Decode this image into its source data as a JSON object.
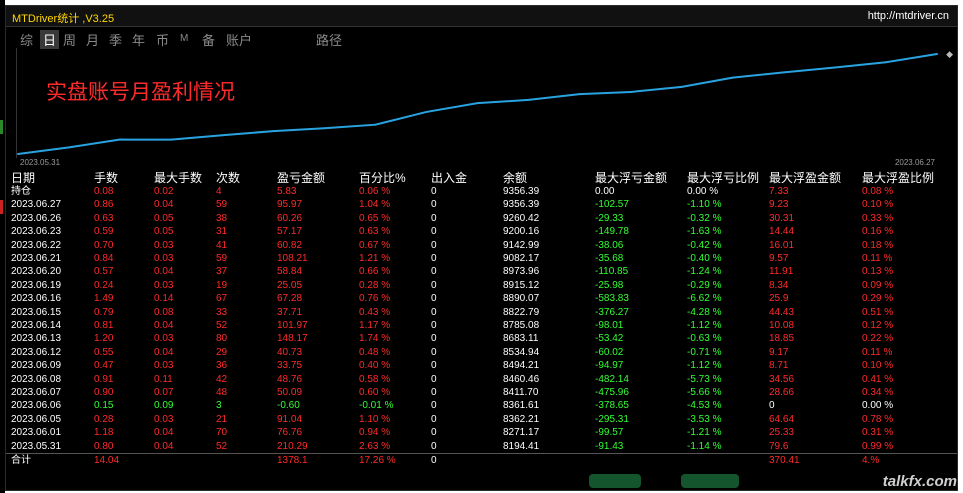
{
  "app": {
    "title": "MTDriver统计 ,V3.25",
    "site": "http://mtdriver.cn"
  },
  "tabs": [
    {
      "label": "综",
      "active": false
    },
    {
      "label": "日",
      "active": true
    },
    {
      "label": "周",
      "active": false
    },
    {
      "label": "月",
      "active": false
    },
    {
      "label": "季",
      "active": false
    },
    {
      "label": "年",
      "active": false
    },
    {
      "label": "币",
      "active": false
    },
    {
      "label": "M",
      "active": false
    },
    {
      "label": "备",
      "active": false
    },
    {
      "label": "账户",
      "active": false
    },
    {
      "label": "路径",
      "active": false
    }
  ],
  "chart_data": {
    "type": "line",
    "title": "实盘账号月盈利情况",
    "x_start_label": "2023.05.31",
    "x_end_label": "2023.06.27",
    "x": [
      "2023.05.31",
      "2023.06.01",
      "2023.06.05",
      "2023.06.06",
      "2023.06.07",
      "2023.06.08",
      "2023.06.09",
      "2023.06.12",
      "2023.06.13",
      "2023.06.14",
      "2023.06.15",
      "2023.06.16",
      "2023.06.19",
      "2023.06.20",
      "2023.06.21",
      "2023.06.22",
      "2023.06.23",
      "2023.06.26",
      "2023.06.27"
    ],
    "values": [
      8194.41,
      8271.17,
      8362.21,
      8361.61,
      8411.7,
      8460.46,
      8494.21,
      8534.94,
      8683.11,
      8785.08,
      8822.79,
      8890.07,
      8915.12,
      8973.96,
      9082.17,
      9142.99,
      9200.16,
      9260.42,
      9356.39
    ],
    "color": "#29a3e0"
  },
  "table": {
    "headers": [
      "日期",
      "手数",
      "最大手数",
      "次数",
      "盈亏金额",
      "百分比%",
      "出入金",
      "余额",
      "最大浮亏金额",
      "最大浮亏比例",
      "最大浮盈金额",
      "最大浮盈比例"
    ],
    "rows": [
      {
        "date": "持仓",
        "lots": "0.08",
        "maxlots": "0.02",
        "count": "4",
        "pnl": "5.83",
        "pct": "0.06 %",
        "io": "0",
        "balance": "9356.39",
        "maxfl": "0.00",
        "maxflp": "0.00 %",
        "maxfp": "7.33",
        "maxfpp": "0.08 %",
        "sign": "pos",
        "flzero": true
      },
      {
        "date": "2023.06.27",
        "lots": "0.86",
        "maxlots": "0.04",
        "count": "59",
        "pnl": "95.97",
        "pct": "1.04 %",
        "io": "0",
        "balance": "9356.39",
        "maxfl": "-102.57",
        "maxflp": "-1.10 %",
        "maxfp": "9.23",
        "maxfpp": "0.10 %",
        "sign": "pos"
      },
      {
        "date": "2023.06.26",
        "lots": "0.63",
        "maxlots": "0.05",
        "count": "38",
        "pnl": "60.26",
        "pct": "0.65 %",
        "io": "0",
        "balance": "9260.42",
        "maxfl": "-29.33",
        "maxflp": "-0.32 %",
        "maxfp": "30.31",
        "maxfpp": "0.33 %",
        "sign": "pos"
      },
      {
        "date": "2023.06.23",
        "lots": "0.59",
        "maxlots": "0.05",
        "count": "31",
        "pnl": "57.17",
        "pct": "0.63 %",
        "io": "0",
        "balance": "9200.16",
        "maxfl": "-149.78",
        "maxflp": "-1.63 %",
        "maxfp": "14.44",
        "maxfpp": "0.16 %",
        "sign": "pos"
      },
      {
        "date": "2023.06.22",
        "lots": "0.70",
        "maxlots": "0.03",
        "count": "41",
        "pnl": "60.82",
        "pct": "0.67 %",
        "io": "0",
        "balance": "9142.99",
        "maxfl": "-38.06",
        "maxflp": "-0.42 %",
        "maxfp": "16.01",
        "maxfpp": "0.18 %",
        "sign": "pos"
      },
      {
        "date": "2023.06.21",
        "lots": "0.84",
        "maxlots": "0.03",
        "count": "59",
        "pnl": "108.21",
        "pct": "1.21 %",
        "io": "0",
        "balance": "9082.17",
        "maxfl": "-35.68",
        "maxflp": "-0.40 %",
        "maxfp": "9.57",
        "maxfpp": "0.11 %",
        "sign": "pos"
      },
      {
        "date": "2023.06.20",
        "lots": "0.57",
        "maxlots": "0.04",
        "count": "37",
        "pnl": "58.84",
        "pct": "0.66 %",
        "io": "0",
        "balance": "8973.96",
        "maxfl": "-110.85",
        "maxflp": "-1.24 %",
        "maxfp": "11.91",
        "maxfpp": "0.13 %",
        "sign": "pos"
      },
      {
        "date": "2023.06.19",
        "lots": "0.24",
        "maxlots": "0.03",
        "count": "19",
        "pnl": "25.05",
        "pct": "0.28 %",
        "io": "0",
        "balance": "8915.12",
        "maxfl": "-25.98",
        "maxflp": "-0.29 %",
        "maxfp": "8.34",
        "maxfpp": "0.09 %",
        "sign": "pos"
      },
      {
        "date": "2023.06.16",
        "lots": "1.49",
        "maxlots": "0.14",
        "count": "67",
        "pnl": "67.28",
        "pct": "0.76 %",
        "io": "0",
        "balance": "8890.07",
        "maxfl": "-583.83",
        "maxflp": "-6.62 %",
        "maxfp": "25.9",
        "maxfpp": "0.29 %",
        "sign": "pos"
      },
      {
        "date": "2023.06.15",
        "lots": "0.79",
        "maxlots": "0.08",
        "count": "33",
        "pnl": "37.71",
        "pct": "0.43 %",
        "io": "0",
        "balance": "8822.79",
        "maxfl": "-376.27",
        "maxflp": "-4.28 %",
        "maxfp": "44.43",
        "maxfpp": "0.51 %",
        "sign": "pos"
      },
      {
        "date": "2023.06.14",
        "lots": "0.81",
        "maxlots": "0.04",
        "count": "52",
        "pnl": "101.97",
        "pct": "1.17 %",
        "io": "0",
        "balance": "8785.08",
        "maxfl": "-98.01",
        "maxflp": "-1.12 %",
        "maxfp": "10.08",
        "maxfpp": "0.12 %",
        "sign": "pos"
      },
      {
        "date": "2023.06.13",
        "lots": "1.20",
        "maxlots": "0.03",
        "count": "80",
        "pnl": "148.17",
        "pct": "1.74 %",
        "io": "0",
        "balance": "8683.11",
        "maxfl": "-53.42",
        "maxflp": "-0.63 %",
        "maxfp": "18.85",
        "maxfpp": "0.22 %",
        "sign": "pos"
      },
      {
        "date": "2023.06.12",
        "lots": "0.55",
        "maxlots": "0.04",
        "count": "29",
        "pnl": "40.73",
        "pct": "0.48 %",
        "io": "0",
        "balance": "8534.94",
        "maxfl": "-60.02",
        "maxflp": "-0.71 %",
        "maxfp": "9.17",
        "maxfpp": "0.11 %",
        "sign": "pos"
      },
      {
        "date": "2023.06.09",
        "lots": "0.47",
        "maxlots": "0.03",
        "count": "36",
        "pnl": "33.75",
        "pct": "0.40 %",
        "io": "0",
        "balance": "8494.21",
        "maxfl": "-94.97",
        "maxflp": "-1.12 %",
        "maxfp": "8.71",
        "maxfpp": "0.10 %",
        "sign": "pos"
      },
      {
        "date": "2023.06.08",
        "lots": "0.91",
        "maxlots": "0.11",
        "count": "42",
        "pnl": "48.76",
        "pct": "0.58 %",
        "io": "0",
        "balance": "8460.46",
        "maxfl": "-482.14",
        "maxflp": "-5.73 %",
        "maxfp": "34.56",
        "maxfpp": "0.41 %",
        "sign": "pos"
      },
      {
        "date": "2023.06.07",
        "lots": "0.90",
        "maxlots": "0.07",
        "count": "48",
        "pnl": "50.09",
        "pct": "0.60 %",
        "io": "0",
        "balance": "8411.70",
        "maxfl": "-475.96",
        "maxflp": "-5.66 %",
        "maxfp": "28.66",
        "maxfpp": "0.34 %",
        "sign": "pos"
      },
      {
        "date": "2023.06.06",
        "lots": "0.15",
        "maxlots": "0.09",
        "count": "3",
        "pnl": "-0.60",
        "pct": "-0.01 %",
        "io": "0",
        "balance": "8361.61",
        "maxfl": "-378.65",
        "maxflp": "-4.53 %",
        "maxfp": "0",
        "maxfpp": "0.00 %",
        "sign": "neg"
      },
      {
        "date": "2023.06.05",
        "lots": "0.28",
        "maxlots": "0.03",
        "count": "21",
        "pnl": "91.04",
        "pct": "1.10 %",
        "io": "0",
        "balance": "8362.21",
        "maxfl": "-295.31",
        "maxflp": "-3.53 %",
        "maxfp": "64.64",
        "maxfpp": "0.78 %",
        "sign": "pos"
      },
      {
        "date": "2023.06.01",
        "lots": "1.18",
        "maxlots": "0.04",
        "count": "70",
        "pnl": "76.76",
        "pct": "0.94 %",
        "io": "0",
        "balance": "8271.17",
        "maxfl": "-99.57",
        "maxflp": "-1.21 %",
        "maxfp": "25.33",
        "maxfpp": "0.31 %",
        "sign": "pos"
      },
      {
        "date": "2023.05.31",
        "lots": "0.80",
        "maxlots": "0.04",
        "count": "52",
        "pnl": "210.29",
        "pct": "2.63 %",
        "io": "0",
        "balance": "8194.41",
        "maxfl": "-91.43",
        "maxflp": "-1.14 %",
        "maxfp": "79.6",
        "maxfpp": "0.99 %",
        "sign": "pos"
      }
    ],
    "total": {
      "date": "合计",
      "lots": "14.04",
      "pnl": "1378.1",
      "pct": "17.26 %",
      "io": "0",
      "maxfp": "370.41",
      "maxfpp": "4.%"
    }
  },
  "colors": {
    "positive": "#ff2a2a",
    "negative": "#33ff33",
    "line": "#29a3e0",
    "accent": "#ffd700"
  },
  "watermark": "talkfx.com"
}
